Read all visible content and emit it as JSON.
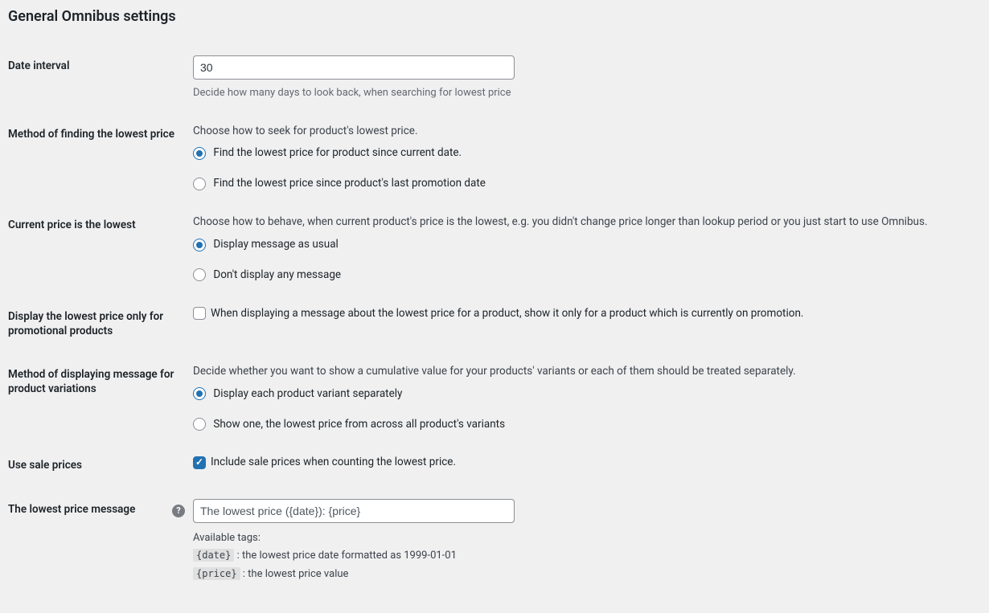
{
  "section_title": "General Omnibus settings",
  "date_interval": {
    "label": "Date interval",
    "value": "30",
    "description": "Decide how many days to look back, when searching for lowest price"
  },
  "method_lowest": {
    "label": "Method of finding the lowest price",
    "description": "Choose how to seek for product's lowest price.",
    "options": {
      "since_current": "Find the lowest price for product since current date.",
      "since_promo": "Find the lowest price since product's last promotion date"
    },
    "selected": "since_current"
  },
  "current_lowest": {
    "label": "Current price is the lowest",
    "description": "Choose how to behave, when current product's price is the lowest, e.g. you didn't change price longer than lookup period or you just start to use Omnibus.",
    "options": {
      "display": "Display message as usual",
      "hide": "Don't display any message"
    },
    "selected": "display"
  },
  "promo_only": {
    "label": "Display the lowest price only for promotional products",
    "option": "When displaying a message about the lowest price for a product, show it only for a product which is currently on promotion.",
    "checked": false
  },
  "variations": {
    "label": "Method of displaying message for product variations",
    "description": "Decide whether you want to show a cumulative value for your products' variants or each of them should be treated separately.",
    "options": {
      "separate": "Display each product variant separately",
      "combined": "Show one, the lowest price from across all product's variants"
    },
    "selected": "separate"
  },
  "sale_prices": {
    "label": "Use sale prices",
    "option": "Include sale prices when counting the lowest price.",
    "checked": true
  },
  "message": {
    "label": "The lowest price message",
    "value": "The lowest price ({date}): {price}",
    "tags_title": "Available tags:",
    "tag_date": "{date}",
    "tag_date_desc": " : the lowest price date formatted as 1999-01-01",
    "tag_price": "{price}",
    "tag_price_desc": " : the lowest price value",
    "help": "?"
  }
}
